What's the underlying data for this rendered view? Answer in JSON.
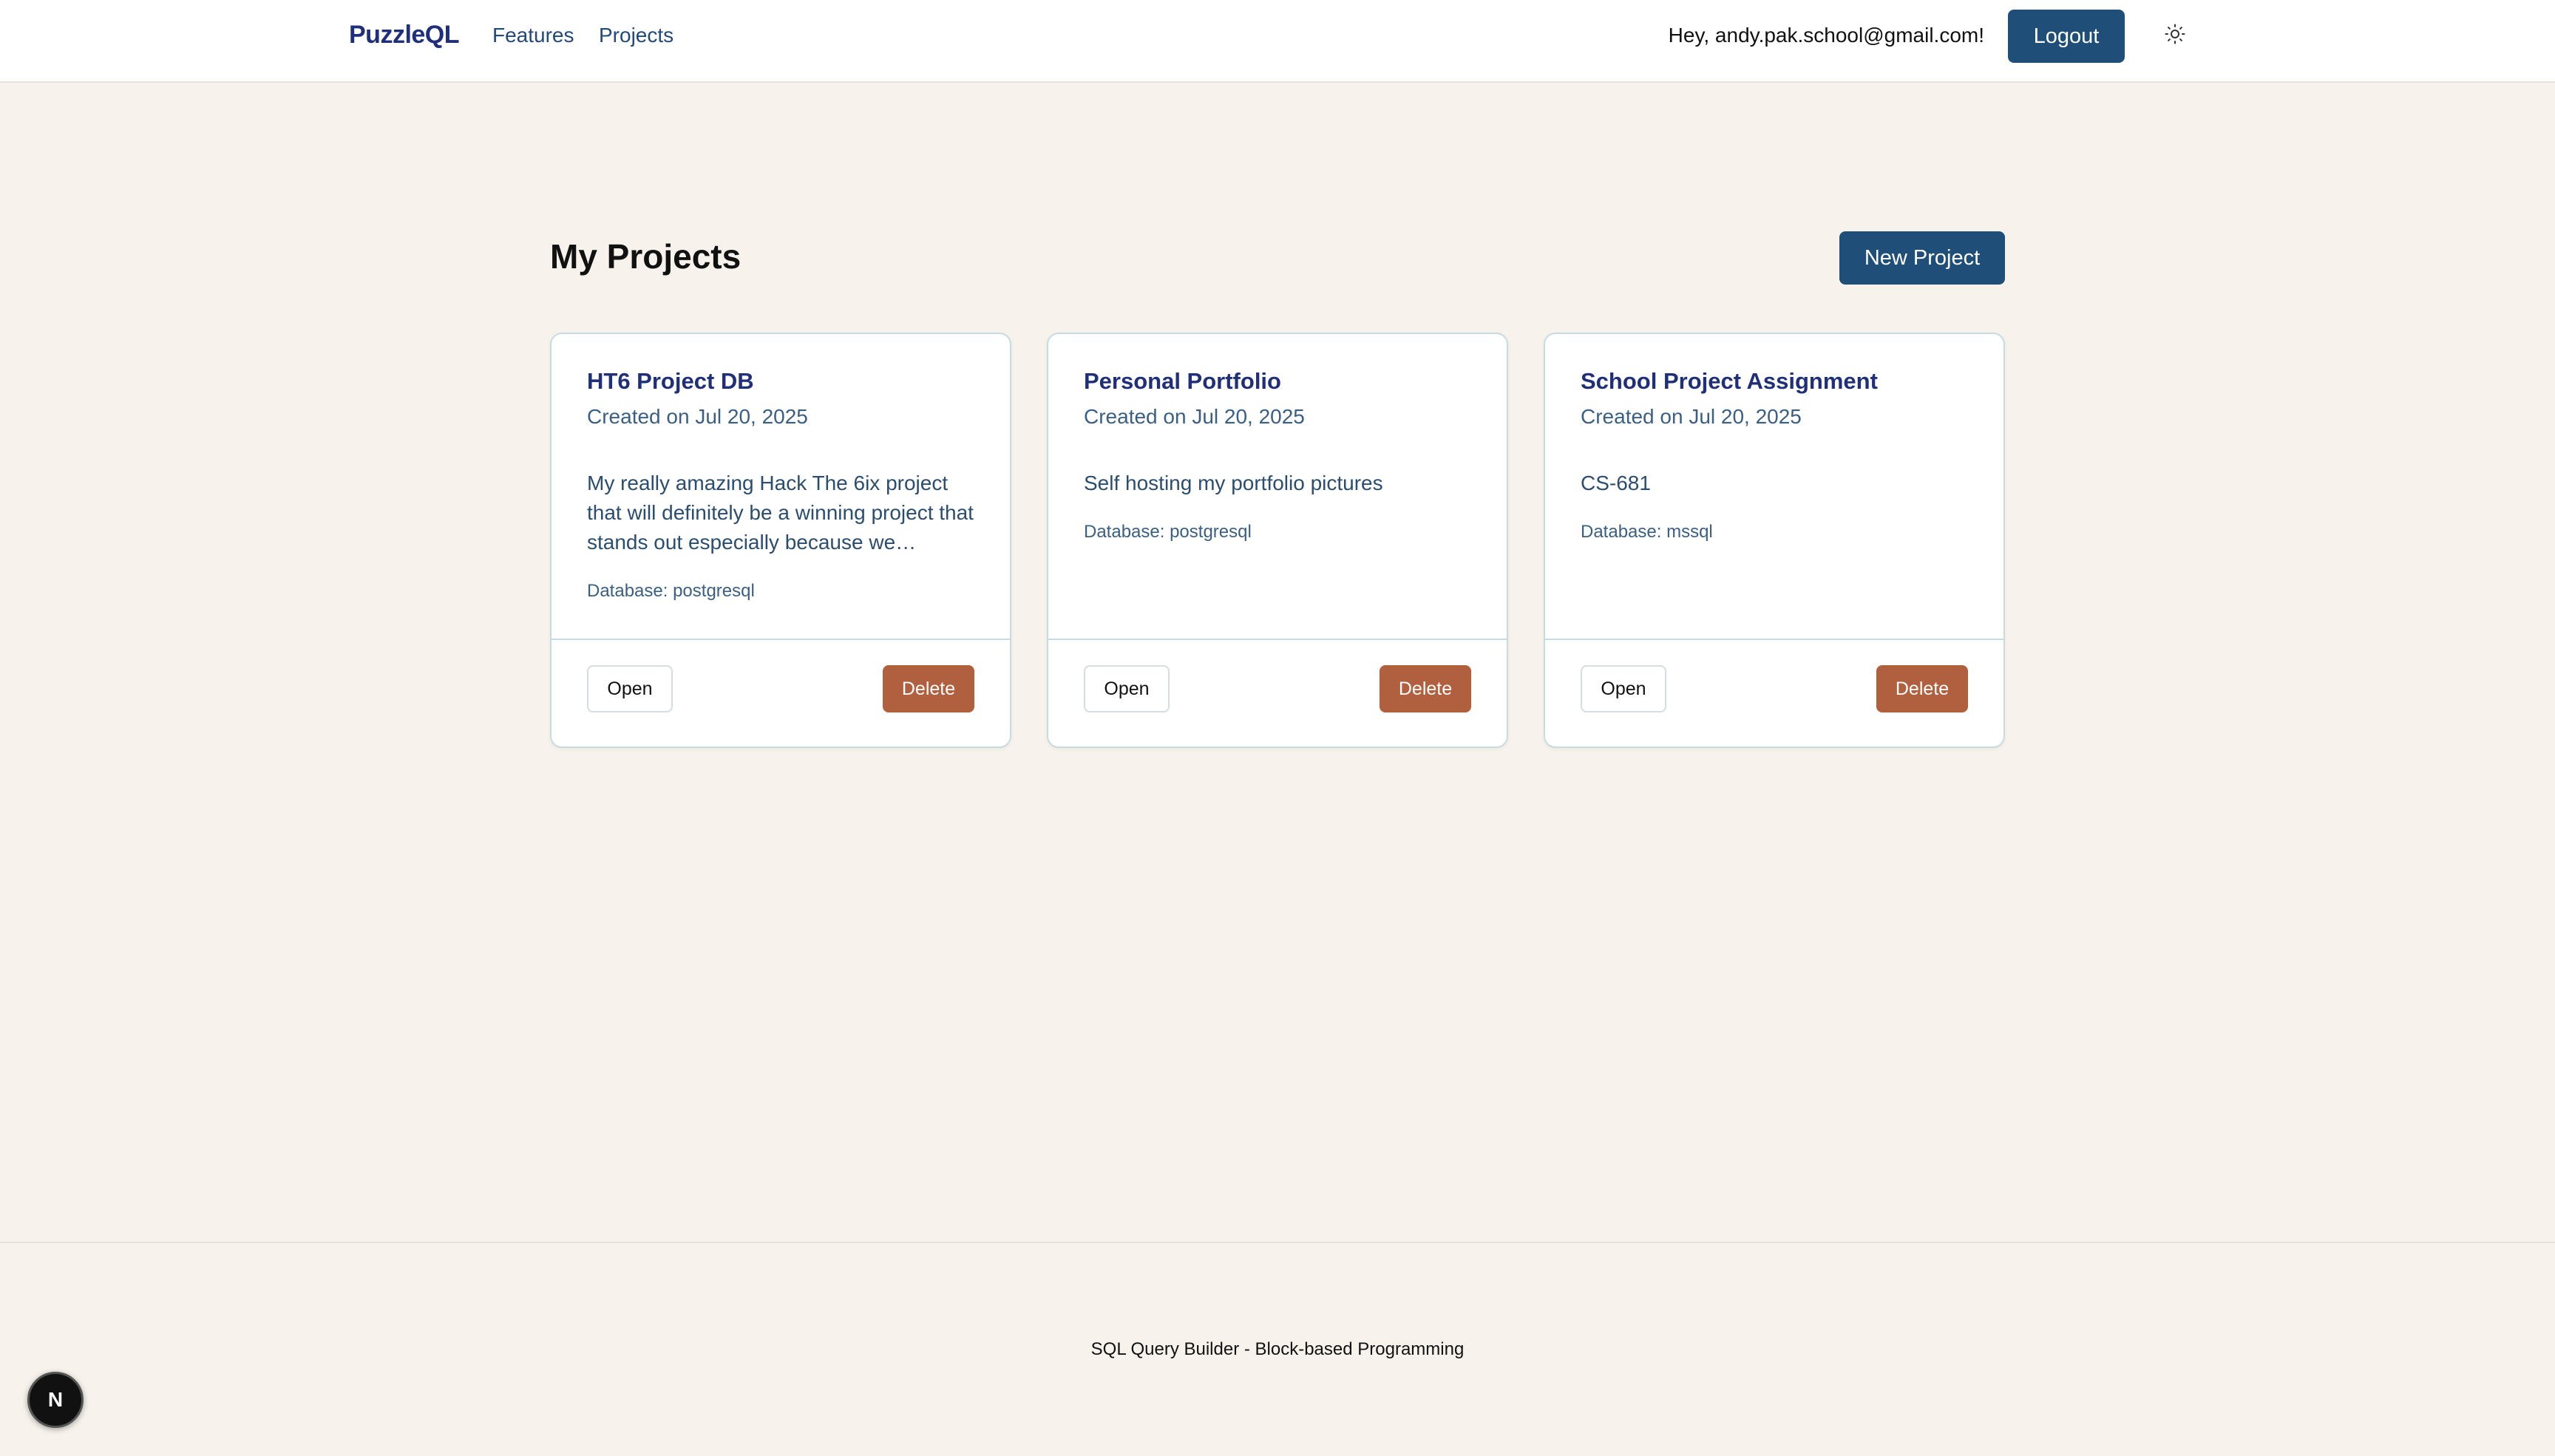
{
  "header": {
    "brand": "PuzzleQL",
    "nav": [
      {
        "label": "Features"
      },
      {
        "label": "Projects"
      }
    ],
    "greeting": "Hey, andy.pak.school@gmail.com!",
    "logout_label": "Logout",
    "theme_icon": "sun-icon"
  },
  "main": {
    "title": "My Projects",
    "new_project_label": "New Project",
    "projects": [
      {
        "name": "HT6 Project DB",
        "created": "Created on Jul 20, 2025",
        "description": "My really amazing Hack The 6ix project that will definitely be a winning project that stands out especially because we…",
        "database": "Database: postgresql",
        "open_label": "Open",
        "delete_label": "Delete"
      },
      {
        "name": "Personal Portfolio",
        "created": "Created on Jul 20, 2025",
        "description": "Self hosting my portfolio pictures",
        "database": "Database: postgresql",
        "open_label": "Open",
        "delete_label": "Delete"
      },
      {
        "name": "School Project Assignment",
        "created": "Created on Jul 20, 2025",
        "description": "CS-681",
        "database": "Database: mssql",
        "open_label": "Open",
        "delete_label": "Delete"
      }
    ]
  },
  "footer": {
    "text": "SQL Query Builder - Block-based Programming"
  },
  "devtools": {
    "icon": "nextjs-icon",
    "letter": "N"
  },
  "colors": {
    "background": "#f7f3ec",
    "primary": "#1f4e79",
    "brand": "#1f2f7a",
    "danger": "#b0603f",
    "card_border": "#c7dbe2"
  }
}
